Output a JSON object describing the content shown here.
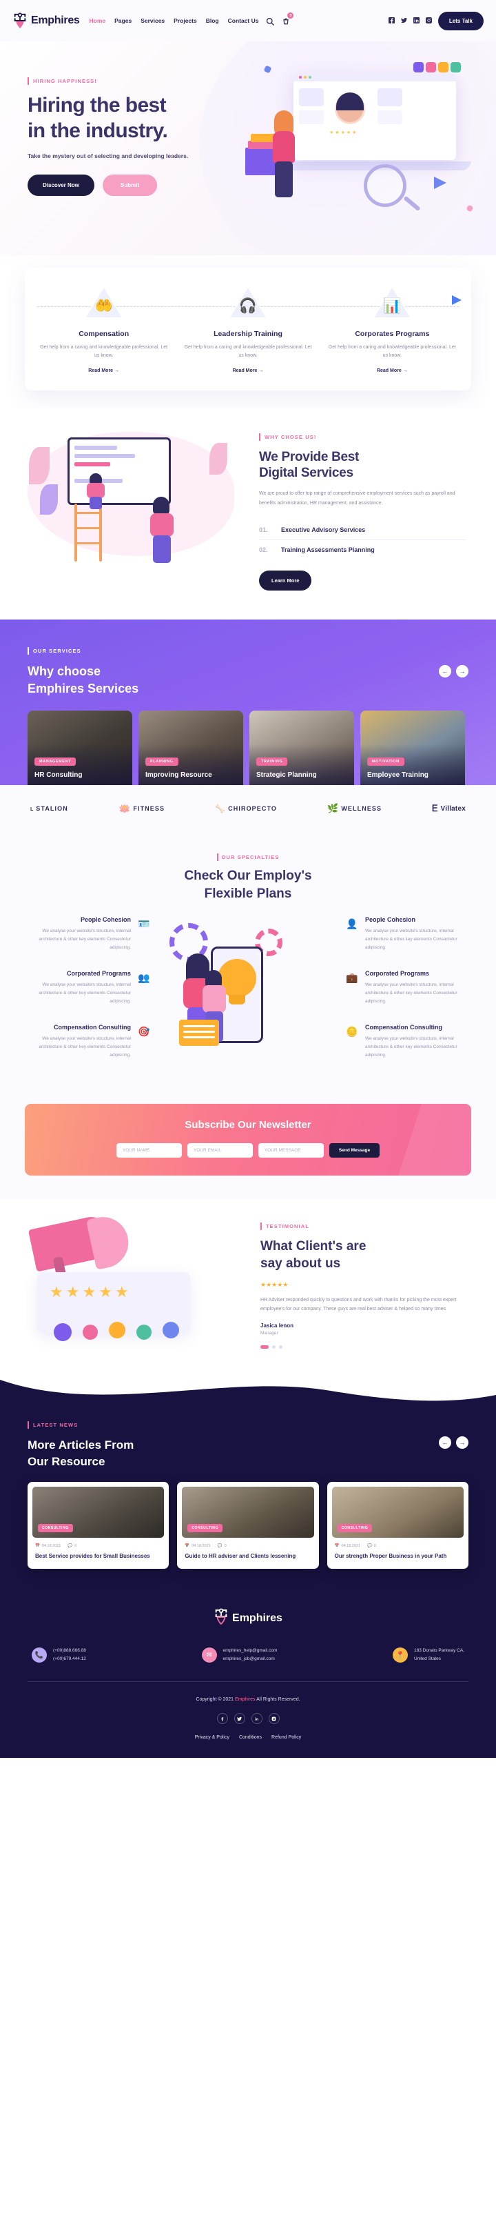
{
  "header": {
    "brand": "Emphires",
    "nav": [
      {
        "label": "Home",
        "active": true
      },
      {
        "label": "Pages",
        "active": false
      },
      {
        "label": "Services",
        "active": false
      },
      {
        "label": "Projects",
        "active": false
      },
      {
        "label": "Blog",
        "active": false
      },
      {
        "label": "Contact Us",
        "active": false
      }
    ],
    "cart_count": "0",
    "cta": "Lets Talk",
    "social": [
      "facebook",
      "twitter",
      "linkedin",
      "instagram"
    ]
  },
  "hero": {
    "eyebrow": "HIRING HAPPINESS!",
    "title_line1": "Hiring the best",
    "title_line2": "in the industry.",
    "subtitle": "Take the mystery out of selecting and developing leaders.",
    "btn_primary": "Discover Now",
    "btn_secondary": "Submit"
  },
  "services": [
    {
      "icon": "hands-heart-icon",
      "title": "Compensation",
      "desc": "Get help from a caring and knowledgeable professional. Let us know.",
      "link": "Read More"
    },
    {
      "icon": "headset-support-icon",
      "title": "Leadership Training",
      "desc": "Get help from a caring and knowledgeable professional. Let us know.",
      "link": "Read More"
    },
    {
      "icon": "growth-chart-icon",
      "title": "Corporates Programs",
      "desc": "Get help from a caring and knowledgeable professional. Let us know.",
      "link": "Read More"
    }
  ],
  "digital": {
    "eyebrow": "WHY CHOSE US!",
    "title_line1": "We Provide Best",
    "title_line2": "Digital Services",
    "desc": "We are proud to offer top range of comprehensive employment services such as payroll and benefits administration, HR management, and assistance.",
    "items": [
      {
        "num": "01.",
        "label": "Executive Advisory Services"
      },
      {
        "num": "02.",
        "label": "Training Assessments Planning"
      }
    ],
    "cta": "Learn More"
  },
  "why": {
    "eyebrow": "OUR SERVICES",
    "title_line1": "Why choose",
    "title_line2": "Emphires Services",
    "prev": "←",
    "next": "→",
    "cards": [
      {
        "tag": "MANAGEMENT",
        "title": "HR Consulting"
      },
      {
        "tag": "PLANNING",
        "title": "Improving Resource"
      },
      {
        "tag": "TRAINING",
        "title": "Strategic Planning"
      },
      {
        "tag": "MOTIVATION",
        "title": "Employee Training"
      }
    ]
  },
  "brands": [
    {
      "name": "STALION",
      "icon": "l-mark-icon"
    },
    {
      "name": "FITNESS",
      "icon": "lotus-icon"
    },
    {
      "name": "CHIROPECTO",
      "icon": "spine-icon"
    },
    {
      "name": "WELLNESS",
      "icon": "palm-icon"
    },
    {
      "name": "Villatex",
      "icon": "e-badge-icon"
    }
  ],
  "plans": {
    "eyebrow": "OUR SPECIALTIES",
    "title_line1": "Check Our Employ's",
    "title_line2": "Flexible Plans",
    "left": [
      {
        "icon": "user-card-icon",
        "title": "People Cohesion",
        "desc": "We analyse your website's structure, internal architecture & other key elements Consectetur adipiscing."
      },
      {
        "icon": "group-bulb-icon",
        "title": "Corporated Programs",
        "desc": "We analyse your website's structure, internal architecture & other key elements Consectetur adipiscing."
      },
      {
        "icon": "target-chart-icon",
        "title": "Compensation Consulting",
        "desc": "We analyse your website's structure, internal architecture & other key elements Consectetur adipiscing."
      }
    ],
    "right": [
      {
        "icon": "people-network-icon",
        "title": "People Cohesion",
        "desc": "We analyse your website's structure, internal architecture & other key elements Consectetur adipiscing."
      },
      {
        "icon": "briefcase-team-icon",
        "title": "Corporated Programs",
        "desc": "We analyse your website's structure, internal architecture & other key elements Consectetur adipiscing."
      },
      {
        "icon": "coins-icon",
        "title": "Compensation Consulting",
        "desc": "We analyse your website's structure, internal architecture & other key elements Consectetur adipiscing."
      }
    ]
  },
  "newsletter": {
    "title": "Subscribe Our Newsletter",
    "name_placeholder": "YOUR NAME",
    "email_placeholder": "YOUR EMAIL",
    "subject_placeholder": "YOUR MESSAGE",
    "button": "Send Message"
  },
  "testimonial": {
    "eyebrow": "TESTIMONIAL",
    "title_line1": "What Client's are",
    "title_line2": "say about us",
    "stars": "★★★★★",
    "quote": "HR Adviser responded quickly to questions and work with thanks for picking the most expert employee's for our company. These guys are real best adviser &  helped so many times",
    "author": "Jasica lenon",
    "role": "Manager"
  },
  "latest": {
    "eyebrow": "LATEST NEWS",
    "title_line1": "More Articles From",
    "title_line2": "Our Resource",
    "prev": "←",
    "next": "→",
    "posts": [
      {
        "tag": "CONSULTING",
        "date": "04.18.2021",
        "comments": "0",
        "title": "Best Service provides for Small Businesses"
      },
      {
        "tag": "CONSULTING",
        "date": "04.18.2021",
        "comments": "0",
        "title": "Guide to HR adviser and Clients lessening"
      },
      {
        "tag": "CONSULTING",
        "date": "04.18.2021",
        "comments": "0",
        "title": "Our strength Proper Business in your Path"
      }
    ]
  },
  "footer": {
    "brand": "Emphires",
    "contacts": [
      {
        "icon": "phone-icon",
        "color": "#b9a8f5",
        "lines": [
          "(+00)888.666.88",
          "(+00)679.444.12"
        ]
      },
      {
        "icon": "mail-icon",
        "color": "#f48cb8",
        "lines": [
          "emphires_help@gmail.com",
          "emphires_job@gmail.com"
        ]
      },
      {
        "icon": "location-icon",
        "color": "#f5b944",
        "lines": [
          "183 Donato Parkway CA,",
          "United States"
        ]
      }
    ],
    "copyright_pre": "Copyright © 2021 ",
    "copyright_brand": "Emphires",
    "copyright_post": " All Rights Reserved.",
    "social": [
      "facebook",
      "twitter",
      "linkedin",
      "instagram"
    ],
    "links": [
      "Privacy & Policy",
      "Conditions",
      "Refund Policy"
    ]
  }
}
